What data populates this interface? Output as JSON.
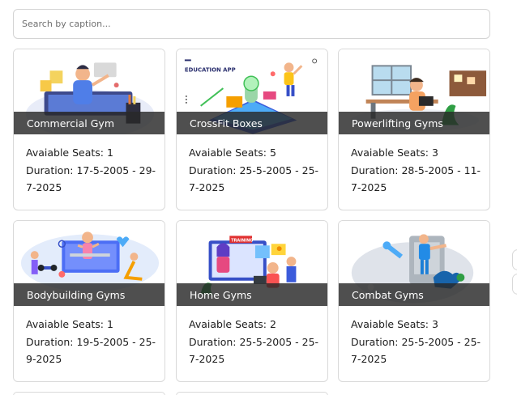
{
  "search": {
    "placeholder": "Search by caption..."
  },
  "cards": [
    {
      "caption": "Commercial Gym",
      "seats_label": "Avaiable Seats: 1",
      "duration_label": "Duration: 17-5-2005 - 29-7-2025"
    },
    {
      "caption": "CrossFit Boxes",
      "seats_label": "Avaiable Seats: 5",
      "duration_label": "Duration: 25-5-2005 - 25-7-2025",
      "image_text": "EDUCATION APP"
    },
    {
      "caption": "Powerlifting Gyms",
      "seats_label": "Avaiable Seats: 3",
      "duration_label": "Duration: 28-5-2005 - 11-7-2025"
    },
    {
      "caption": "Bodybuilding Gyms",
      "seats_label": "Avaiable Seats: 1",
      "duration_label": "Duration: 19-5-2005 - 25-9-2025"
    },
    {
      "caption": "Home Gyms",
      "seats_label": "Avaiable Seats: 2",
      "duration_label": "Duration: 25-5-2005 - 25-7-2025",
      "image_text": "TRAINING"
    },
    {
      "caption": "Combat Gyms",
      "seats_label": "Avaiable Seats: 3",
      "duration_label": "Duration: 25-5-2005 - 25-7-2025"
    }
  ]
}
